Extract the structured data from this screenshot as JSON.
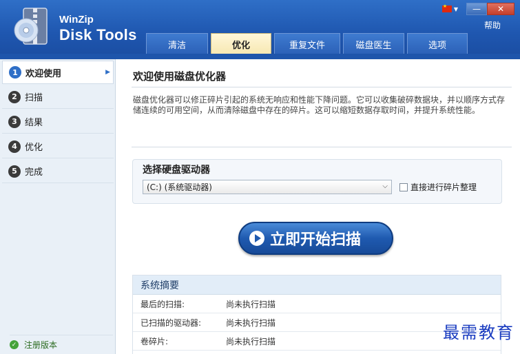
{
  "app": {
    "brand_small": "WinZip",
    "brand_big": "Disk Tools",
    "help_label": "帮助",
    "minimize": "—",
    "close": "✕"
  },
  "tabs": [
    {
      "label": "清洁",
      "active": false
    },
    {
      "label": "优化",
      "active": true
    },
    {
      "label": "重复文件",
      "active": false
    },
    {
      "label": "磁盘医生",
      "active": false
    },
    {
      "label": "选项",
      "active": false
    }
  ],
  "sidebar": {
    "steps": [
      {
        "num": "1",
        "label": "欢迎使用",
        "active": true
      },
      {
        "num": "2",
        "label": "扫描",
        "active": false
      },
      {
        "num": "3",
        "label": "结果",
        "active": false
      },
      {
        "num": "4",
        "label": "优化",
        "active": false
      },
      {
        "num": "5",
        "label": "完成",
        "active": false
      }
    ],
    "register_label": "注册版本"
  },
  "main": {
    "title": "欢迎使用磁盘优化器",
    "description": "磁盘优化器可以修正碎片引起的系统无响应和性能下降问题。它可以收集破碎数据块，并以顺序方式存储连续的可用空间，从而清除磁盘中存在的碎片。这可以缩短数据存取时间，并提升系统性能。",
    "drive_section_label": "选择硬盘驱动器",
    "drive_selected": "(C:)  (系统驱动器)",
    "direct_defrag_label": "直接进行碎片整理",
    "scan_button_label": "立即开始扫描"
  },
  "summary": {
    "header": "系统摘要",
    "rows": [
      {
        "key": "最后的扫描:",
        "value": "尚未执行扫描"
      },
      {
        "key": "已扫描的驱动器:",
        "value": "尚未执行扫描"
      },
      {
        "key": "卷碎片:",
        "value": "尚未执行扫描"
      }
    ]
  },
  "watermark": "最需教育",
  "colors": {
    "header_blue": "#1f57b0",
    "active_tab": "#f6e7b0",
    "sidebar_bg": "#e9f0f7",
    "scan_button": "#1f5ab0"
  }
}
